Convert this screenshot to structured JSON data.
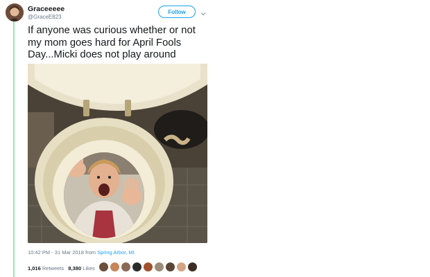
{
  "tweet": {
    "display_name": "Graceeeee",
    "handle": "@GraceE823",
    "follow_label": "Follow",
    "text": "If anyone was curious whether or not my mom goes hard for April Fools Day...Micki does not play around",
    "time": "10:42 PM - 31 Mar 2018",
    "from_label": "from",
    "location": "Spring Arbor, MI",
    "retweets_count": "1,016",
    "retweets_label": "Retweets",
    "likes_count": "8,380",
    "likes_label": "Likes"
  },
  "colors": {
    "accent": "#1da1f2",
    "thread_line": "#9be5b0",
    "secondary_text": "#657786"
  },
  "icons": {
    "caret": "chevron-down-icon"
  },
  "likers": [
    "#6b4f3a",
    "#c7865a",
    "#8a6a55",
    "#2b2b2b",
    "#a0522d",
    "#9c8b7a",
    "#5a4636",
    "#d4a582",
    "#3d2c22"
  ]
}
